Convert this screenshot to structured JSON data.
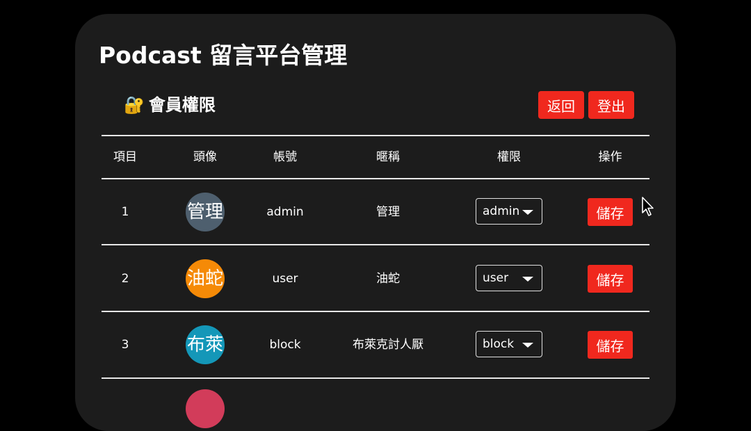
{
  "app": {
    "title": "Podcast 留言平台管理"
  },
  "section": {
    "icon": "lock-with-key-icon",
    "title": "會員權限"
  },
  "actions": {
    "back_label": "返回",
    "logout_label": "登出"
  },
  "table": {
    "headers": [
      "項目",
      "頭像",
      "帳號",
      "暱稱",
      "權限",
      "操作"
    ],
    "rows": [
      {
        "index": "1",
        "avatar_text": "管理",
        "avatar_color": "#4e5f6e",
        "account": "admin",
        "nickname": "管理",
        "role": "admin",
        "action_label": "儲存"
      },
      {
        "index": "2",
        "avatar_text": "油蛇",
        "avatar_color": "#f58a07",
        "account": "user",
        "nickname": "油蛇",
        "role": "user",
        "action_label": "儲存"
      },
      {
        "index": "3",
        "avatar_text": "布萊",
        "avatar_color": "#1497b8",
        "account": "block",
        "nickname": "布萊克討人厭",
        "role": "block",
        "action_label": "儲存"
      }
    ]
  },
  "colors": {
    "accent": "#f0281e",
    "panel_bg": "#1c1c1c",
    "page_bg": "#000000"
  }
}
